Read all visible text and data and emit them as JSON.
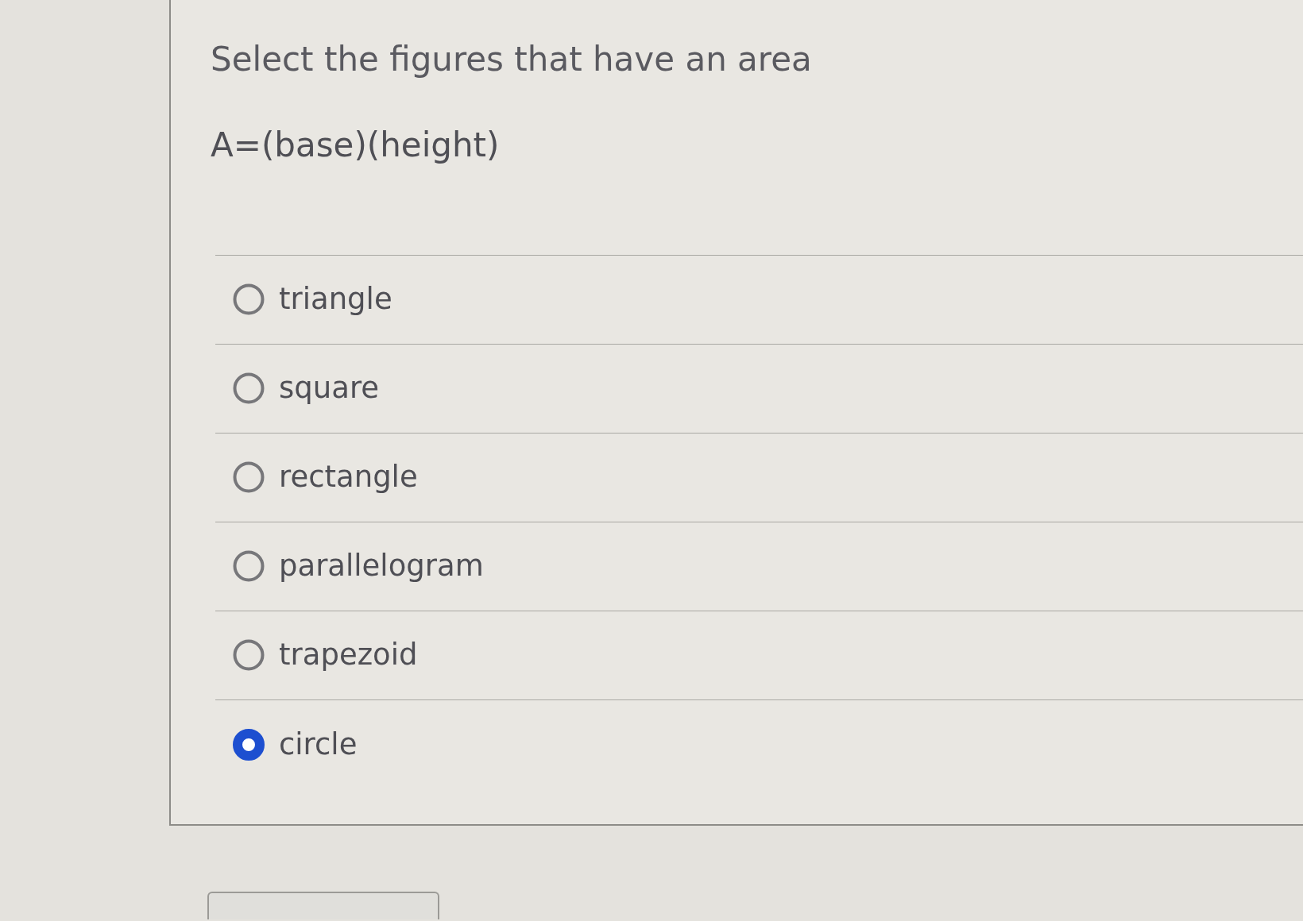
{
  "question": {
    "prompt": "Select the figures that have an area",
    "formula": "A=(base)(height)"
  },
  "options": [
    {
      "label": "triangle",
      "selected": false
    },
    {
      "label": "square",
      "selected": false
    },
    {
      "label": "rectangle",
      "selected": false
    },
    {
      "label": "parallelogram",
      "selected": false
    },
    {
      "label": "trapezoid",
      "selected": false
    },
    {
      "label": "circle",
      "selected": true
    }
  ]
}
